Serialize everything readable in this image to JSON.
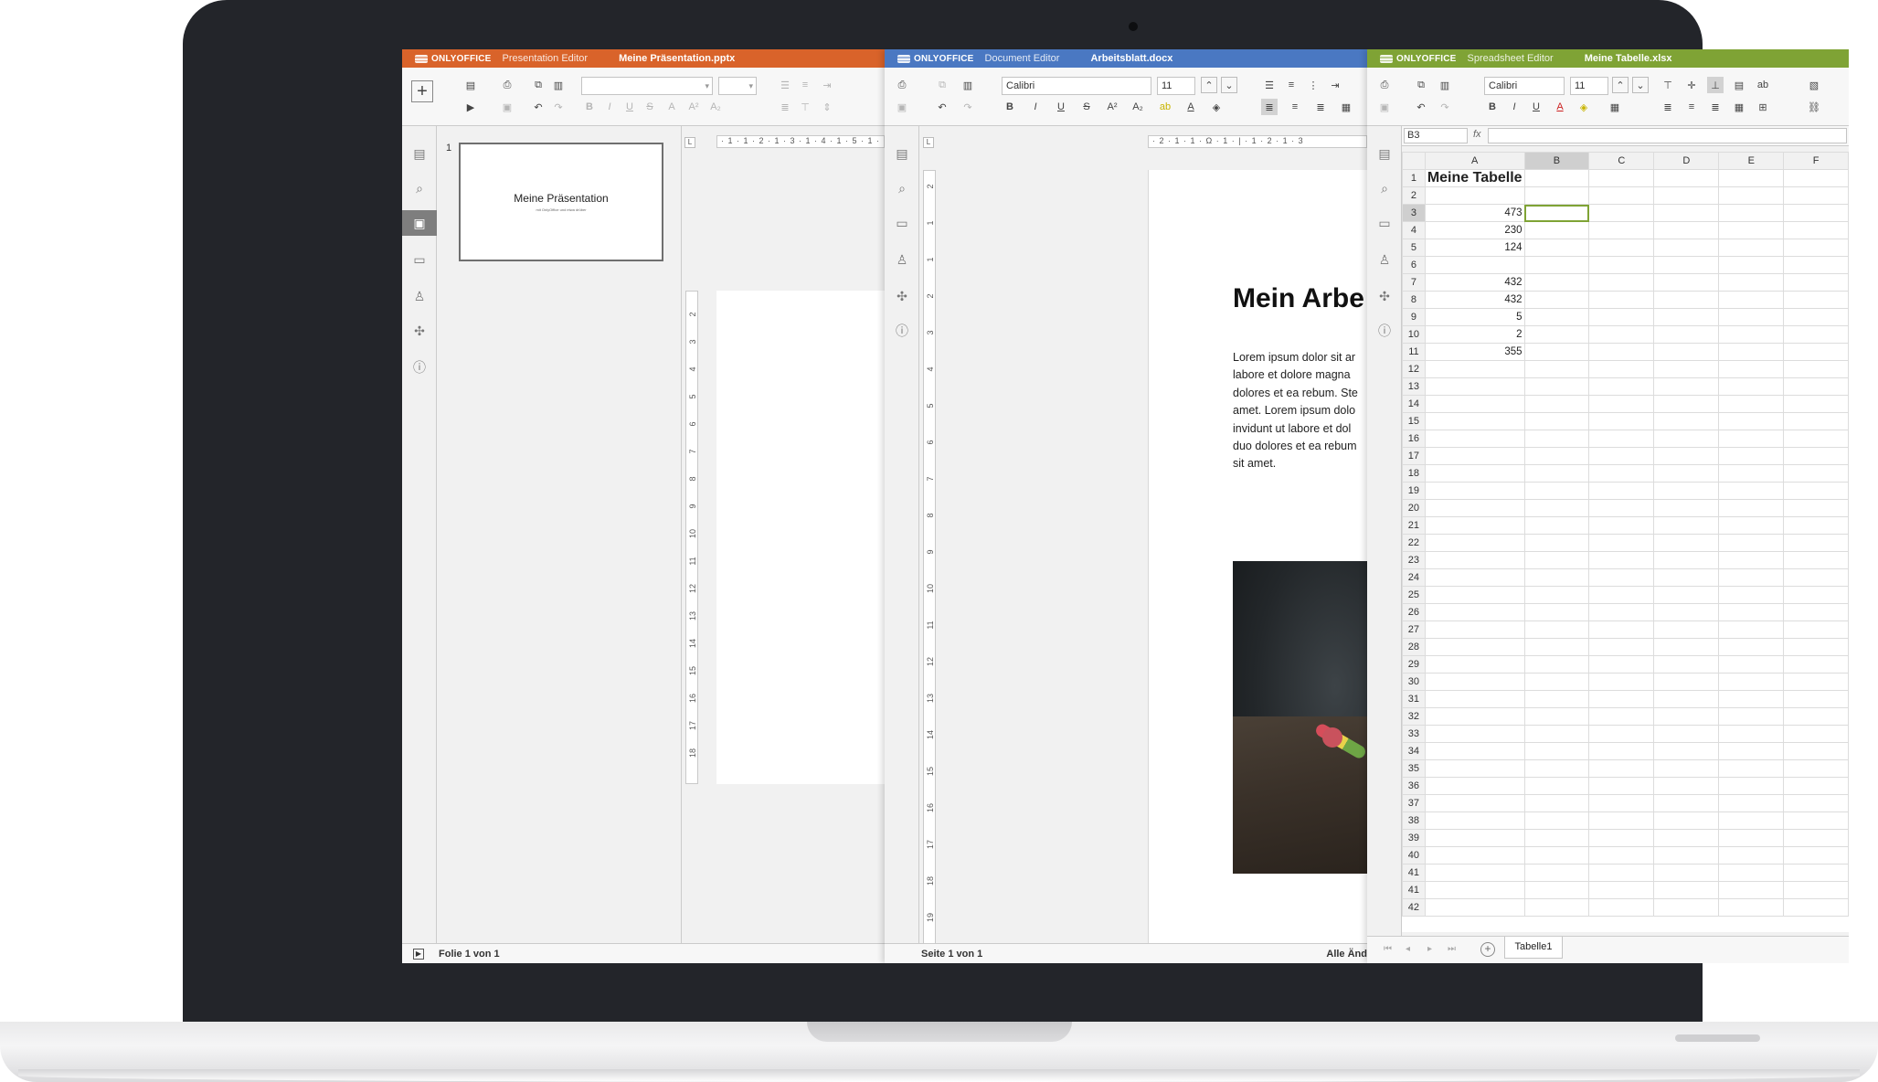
{
  "presentation": {
    "brand": "ONLYOFFICE",
    "editor_type": "Presentation Editor",
    "file_name": "Meine Präsentation.pptx",
    "slide_number": "1",
    "slide_title": "Meine Präsentation",
    "slide_subtitle": "mit OnlyOffice und etwa drüber",
    "status": "Folie 1 von 1",
    "ruler_h": "· 1 · 1 · 2 · 1 · 3 · 1 · 4 · 1 · 5 · 1 · 6",
    "ruler_v": [
      "2",
      "3",
      "4",
      "5",
      "6",
      "7",
      "8",
      "9",
      "10",
      "11",
      "12",
      "13",
      "14",
      "15",
      "16",
      "17",
      "18"
    ],
    "colors": {
      "title": "#d9632a"
    }
  },
  "document": {
    "brand": "ONLYOFFICE",
    "editor_type": "Document Editor",
    "file_name": "Arbeitsblatt.docx",
    "font_name": "Calibri",
    "font_size": "11",
    "heading": "Mein Arbe",
    "body_lines": [
      "Lorem ipsum dolor sit ar",
      "labore et dolore magna",
      "dolores et ea rebum. Ste",
      "amet. Lorem ipsum dolo",
      "invidunt ut labore et dol",
      "duo dolores et ea rebum",
      "sit amet."
    ],
    "status": "Seite 1 von 1",
    "status_right": "Alle Änd",
    "ruler_h": "· 2 · 1 · 1 · Ω · 1 · | · 1 · 2 · 1 · 3",
    "ruler_v": [
      "2",
      "1",
      "1",
      "2",
      "3",
      "4",
      "5",
      "6",
      "7",
      "8",
      "9",
      "10",
      "11",
      "12",
      "13",
      "14",
      "15",
      "16",
      "17",
      "18",
      "19"
    ],
    "colors": {
      "title": "#4a78c2"
    }
  },
  "spreadsheet": {
    "brand": "ONLYOFFICE",
    "editor_type": "Spreadsheet Editor",
    "file_name": "Meine Tabelle.xlsx",
    "font_name": "Calibri",
    "font_size": "11",
    "cell_ref": "B3",
    "fx_label": "fx",
    "columns": [
      "A",
      "B",
      "C",
      "D",
      "E",
      "F"
    ],
    "rows": [
      {
        "n": "1",
        "a": "Meine Tabelle"
      },
      {
        "n": "2",
        "a": ""
      },
      {
        "n": "3",
        "a": "473"
      },
      {
        "n": "4",
        "a": "230"
      },
      {
        "n": "5",
        "a": "124"
      },
      {
        "n": "6",
        "a": ""
      },
      {
        "n": "7",
        "a": "432"
      },
      {
        "n": "8",
        "a": "432"
      },
      {
        "n": "9",
        "a": "5"
      },
      {
        "n": "10",
        "a": "2"
      },
      {
        "n": "11",
        "a": "355"
      },
      {
        "n": "12",
        "a": ""
      },
      {
        "n": "13",
        "a": ""
      },
      {
        "n": "14",
        "a": ""
      },
      {
        "n": "15",
        "a": ""
      },
      {
        "n": "16",
        "a": ""
      },
      {
        "n": "17",
        "a": ""
      },
      {
        "n": "18",
        "a": ""
      },
      {
        "n": "19",
        "a": ""
      },
      {
        "n": "20",
        "a": ""
      },
      {
        "n": "21",
        "a": ""
      },
      {
        "n": "22",
        "a": ""
      },
      {
        "n": "23",
        "a": ""
      },
      {
        "n": "24",
        "a": ""
      },
      {
        "n": "25",
        "a": ""
      },
      {
        "n": "26",
        "a": ""
      },
      {
        "n": "27",
        "a": ""
      },
      {
        "n": "28",
        "a": ""
      },
      {
        "n": "29",
        "a": ""
      },
      {
        "n": "30",
        "a": ""
      },
      {
        "n": "31",
        "a": ""
      },
      {
        "n": "32",
        "a": ""
      },
      {
        "n": "33",
        "a": ""
      },
      {
        "n": "34",
        "a": ""
      },
      {
        "n": "35",
        "a": ""
      },
      {
        "n": "36",
        "a": ""
      },
      {
        "n": "37",
        "a": ""
      },
      {
        "n": "38",
        "a": ""
      },
      {
        "n": "39",
        "a": ""
      },
      {
        "n": "40",
        "a": ""
      },
      {
        "n": "41",
        "a": ""
      },
      {
        "n": "41",
        "a": ""
      },
      {
        "n": "42",
        "a": ""
      }
    ],
    "sheet_tab": "Tabelle1",
    "colors": {
      "title": "#7fa335"
    }
  },
  "toolbar_icons": [
    "plus-icon",
    "layout-icon",
    "print-icon",
    "copy-icon",
    "paste-icon",
    "undo-icon",
    "redo-icon",
    "save-icon",
    "bold-icon",
    "italic-icon",
    "underline-icon",
    "strikethrough-icon",
    "font-color-icon",
    "bullets-icon",
    "numbering-icon",
    "align-left-icon",
    "align-center-icon",
    "align-right-icon",
    "justify-icon"
  ],
  "rail_icons": [
    "slides-icon",
    "search-icon",
    "comments-icon",
    "users-icon",
    "plugins-icon",
    "info-icon"
  ]
}
